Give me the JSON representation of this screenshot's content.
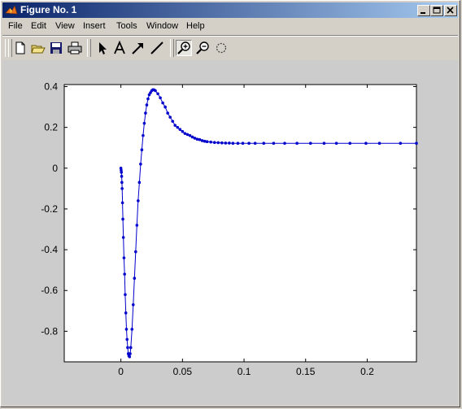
{
  "window": {
    "title": "Figure No. 1"
  },
  "menu": [
    "File",
    "Edit",
    "View",
    "Insert",
    "Tools",
    "Window",
    "Help"
  ],
  "toolbar": {
    "buttons": [
      "new-figure",
      "open-file",
      "save",
      "print",
      "select-arrow",
      "insert-text",
      "insert-arrow",
      "insert-line",
      "zoom-in",
      "zoom-out",
      "rotate-3d"
    ],
    "active": "zoom-in"
  },
  "colors": {
    "line": "#0000cc",
    "axes_bg": "#ffffff",
    "figure_bg": "#cccccc"
  },
  "chart_data": {
    "type": "line",
    "title": "",
    "xlabel": "",
    "ylabel": "",
    "xlim": [
      -0.046,
      0.24
    ],
    "ylim": [
      -0.95,
      0.41
    ],
    "xticks": [
      0,
      0.05,
      0.1,
      0.15,
      0.2
    ],
    "xtick_labels": [
      "0",
      "0.05",
      "0.1",
      "0.15",
      "0.2"
    ],
    "yticks": [
      0.4,
      0.2,
      0,
      -0.2,
      -0.4,
      -0.6,
      -0.8
    ],
    "ytick_labels": [
      "0.4",
      "0.2",
      "0",
      "-0.2",
      "-0.4",
      "-0.6",
      "-0.8"
    ],
    "grid": false,
    "marker": "dot",
    "series": [
      {
        "x": [
          0,
          0.0002,
          0.0004,
          0.0006,
          0.0008,
          0.001,
          0.0013,
          0.0016,
          0.002,
          0.0025,
          0.003,
          0.0035,
          0.004,
          0.0045,
          0.005,
          0.0055,
          0.006,
          0.0065,
          0.007,
          0.0075,
          0.008,
          0.009,
          0.01,
          0.011,
          0.012,
          0.013,
          0.014,
          0.015,
          0.016,
          0.017,
          0.018,
          0.019,
          0.02,
          0.021,
          0.022,
          0.023,
          0.024,
          0.025,
          0.026,
          0.027,
          0.028,
          0.03,
          0.032,
          0.034,
          0.036,
          0.038,
          0.04,
          0.042,
          0.044,
          0.046,
          0.048,
          0.05,
          0.052,
          0.054,
          0.056,
          0.058,
          0.06,
          0.062,
          0.064,
          0.066,
          0.068,
          0.07,
          0.073,
          0.076,
          0.079,
          0.082,
          0.085,
          0.088,
          0.091,
          0.095,
          0.099,
          0.104,
          0.109,
          0.116,
          0.124,
          0.133,
          0.143,
          0.154,
          0.165,
          0.175,
          0.186,
          0.199,
          0.21,
          0.227,
          0.24
        ],
        "y": [
          0,
          -0.01,
          -0.02,
          -0.04,
          -0.07,
          -0.1,
          -0.17,
          -0.25,
          -0.34,
          -0.44,
          -0.52,
          -0.62,
          -0.71,
          -0.79,
          -0.84,
          -0.88,
          -0.91,
          -0.92,
          -0.925,
          -0.91,
          -0.88,
          -0.79,
          -0.67,
          -0.54,
          -0.41,
          -0.28,
          -0.16,
          -0.07,
          0.02,
          0.09,
          0.16,
          0.22,
          0.27,
          0.31,
          0.34,
          0.36,
          0.37,
          0.38,
          0.385,
          0.384,
          0.38,
          0.365,
          0.345,
          0.32,
          0.3,
          0.27,
          0.25,
          0.23,
          0.21,
          0.2,
          0.19,
          0.18,
          0.17,
          0.165,
          0.16,
          0.153,
          0.147,
          0.142,
          0.14,
          0.135,
          0.132,
          0.13,
          0.128,
          0.126,
          0.125,
          0.124,
          0.123,
          0.123,
          0.122,
          0.122,
          0.122,
          0.122,
          0.122,
          0.122,
          0.122,
          0.122,
          0.122,
          0.122,
          0.122,
          0.122,
          0.122,
          0.122,
          0.122,
          0.122,
          0.122
        ]
      }
    ]
  }
}
